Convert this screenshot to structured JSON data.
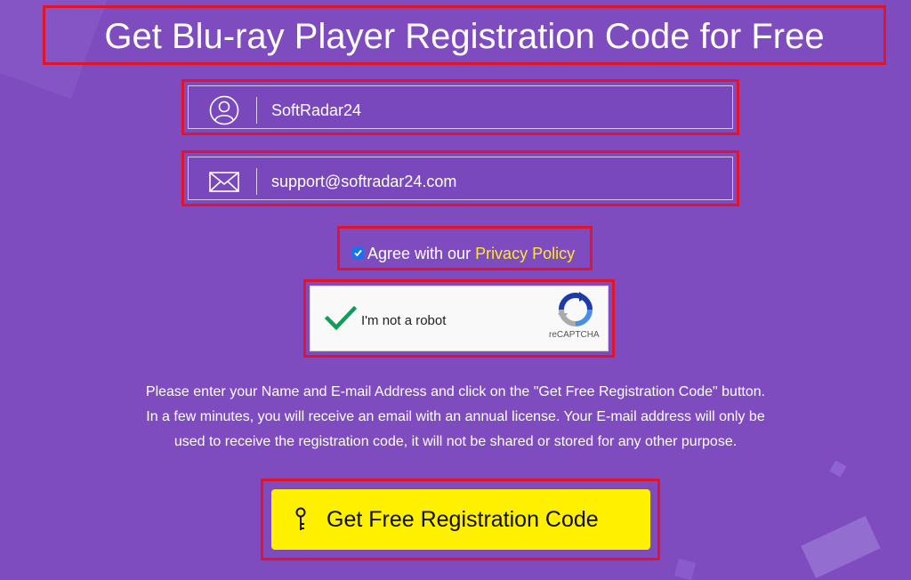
{
  "page": {
    "title": "Get Blu-ray Player Registration Code for Free"
  },
  "form": {
    "name_value": "SoftRadar24",
    "email_value": "support@softradar24.com",
    "agree_text": "Agree with our ",
    "agree_link": "Privacy Policy",
    "agree_checked": true
  },
  "captcha": {
    "label": "I'm not a robot",
    "brand": "reCAPTCHA",
    "checked": true
  },
  "info": {
    "line1": "Please enter your Name and E-mail Address and click on the \"Get Free Registration Code\" button.",
    "line2": "In a few minutes, you will receive an email with an annual license. Your E-mail address will only be",
    "line3": "used to receive the registration code, it will not be shared or stored for any other purpose."
  },
  "button": {
    "label": "Get Free Registration Code"
  },
  "icons": {
    "name_field": "user-icon",
    "email_field": "envelope-icon",
    "button": "key-icon",
    "captcha_logo": "recaptcha-logo-icon",
    "captcha_check": "check-icon"
  },
  "colors": {
    "background": "#7e4cbf",
    "highlight_border": "#e0142b",
    "link": "#ffe633",
    "button": "#fff000",
    "captcha_check": "#0f9d58"
  }
}
